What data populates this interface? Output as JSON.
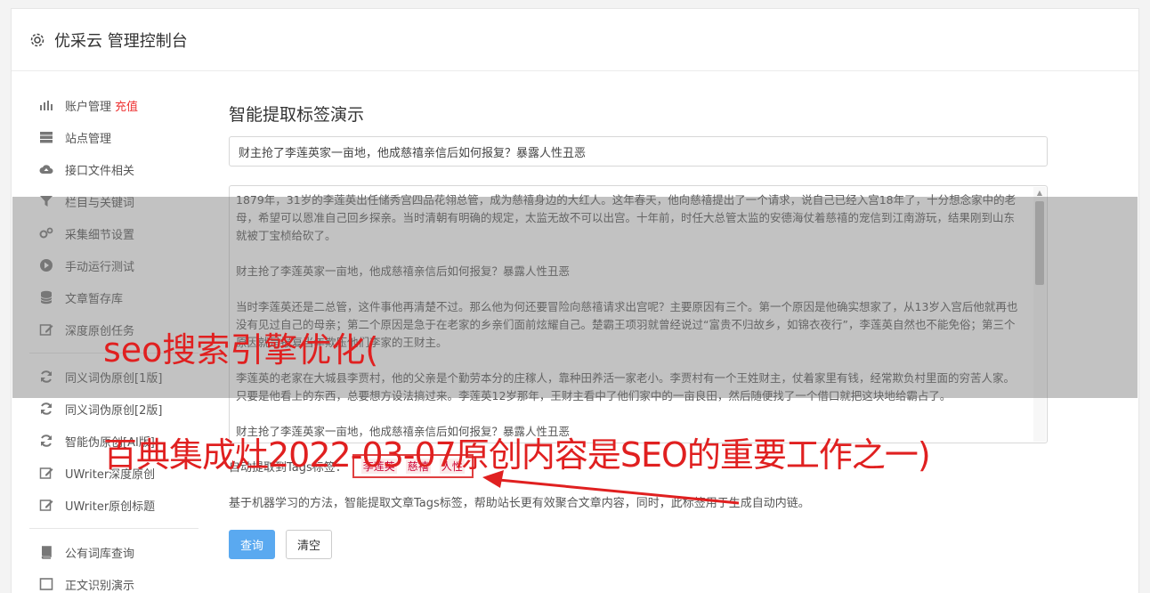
{
  "header": {
    "title": "优采云 管理控制台",
    "icon": "gear-icon"
  },
  "sidebar": {
    "group1": [
      {
        "label": "账户管理",
        "extra": "充值",
        "icon": "bar-chart-icon"
      },
      {
        "label": "站点管理",
        "icon": "server-icon"
      },
      {
        "label": "接口文件相关",
        "icon": "cloud-upload-icon"
      },
      {
        "label": "栏目与关键词",
        "icon": "filter-icon"
      },
      {
        "label": "采集细节设置",
        "icon": "gears-icon"
      },
      {
        "label": "手动运行测试",
        "icon": "play-icon"
      },
      {
        "label": "文章暂存库",
        "icon": "database-icon"
      },
      {
        "label": "深度原创任务",
        "icon": "edit-icon"
      }
    ],
    "group2": [
      {
        "label": "同义词伪原创[1版]",
        "icon": "refresh-icon"
      },
      {
        "label": "同义词伪原创[2版]",
        "icon": "refresh-icon"
      },
      {
        "label": "智能伪原创[AI版]",
        "icon": "refresh-icon"
      },
      {
        "label": "UWriter深度原创",
        "icon": "edit-icon"
      },
      {
        "label": "UWriter原创标题",
        "icon": "edit-icon"
      }
    ],
    "group3": [
      {
        "label": "公有词库查询",
        "icon": "book-icon"
      },
      {
        "label": "正文识别演示",
        "icon": "square-icon"
      }
    ]
  },
  "main": {
    "heading": "智能提取标签演示",
    "title_value": "财主抢了李莲英家一亩地，他成慈禧亲信后如何报复？暴露人性丑恶",
    "paragraphs": [
      "1879年，31岁的李莲英出任储秀宫四品花翎总管，成为慈禧身边的大红人。这年春天，他向慈禧提出了一个请求，说自己已经入宫18年了，十分想念家中的老母，希望可以恩准自己回乡探亲。当时清朝有明确的规定，太监无故不可以出宫。十年前，时任大总管太监的安德海仗着慈禧的宠信到江南游玩，结果刚到山东就被丁宝桢给砍了。",
      "财主抢了李莲英家一亩地，他成慈禧亲信后如何报复？暴露人性丑恶",
      "当时李莲英还是二总管，这件事他再清楚不过。那么他为何还要冒险向慈禧请求出宫呢？主要原因有三个。第一个原因是他确实想家了，从13岁入宫后他就再也没有见过自己的母亲；第二个原因是急于在老家的乡亲们面前炫耀自己。楚霸王项羽就曾经说过“富贵不归故乡，如锦衣夜行”，李莲英自然也不能免俗；第三个原因就是报复当年欺压他们李家的王财主。",
      "李莲英的老家在大城县李贾村，他的父亲是个勤劳本分的庄稼人，靠种田养活一家老小。李贾村有一个王姓财主，仗着家里有钱，经常欺负村里面的穷苦人家。只要是他看上的东西，总要想方设法搞过来。李莲英12岁那年，王财主看中了他们家中的一亩良田，然后随便找了一个借口就把这块地给霸占了。",
      "财主抢了李莲英家一亩地，他成慈禧亲信后如何报复？暴露人性丑恶"
    ],
    "tags_label": "自动提取到Tags标签：",
    "tags": [
      "李莲英",
      "慈禧",
      "人性"
    ],
    "description": "基于机器学习的方法，智能提取文章Tags标签，帮助站长更有效聚合文章内容，同时，此标签用于生成自动内链。",
    "query_button": "查询",
    "clear_button": "清空"
  },
  "overlay": {
    "line1": "seo搜索引擎优化(",
    "line2": "百典集成灶2022-03-07原创内容是SEO的重要工作之一)",
    "color": "#e02020"
  }
}
